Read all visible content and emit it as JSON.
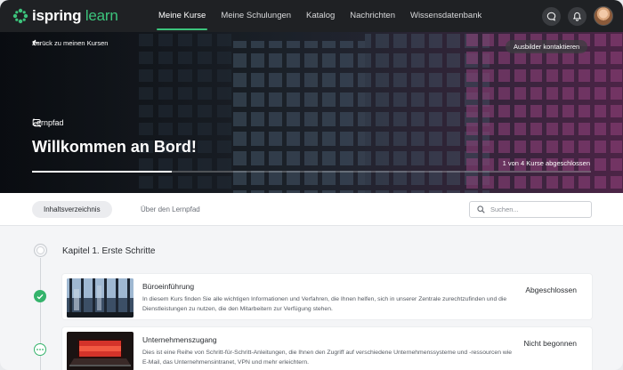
{
  "colors": {
    "accent": "#3cc47c",
    "header_bg": "#1f2124",
    "done": "#34b36b"
  },
  "brand": {
    "name_part1": "ispring",
    "name_part2": "learn"
  },
  "nav": {
    "items": [
      {
        "label": "Meine Kurse",
        "active": true
      },
      {
        "label": "Meine Schulungen",
        "active": false
      },
      {
        "label": "Katalog",
        "active": false
      },
      {
        "label": "Nachrichten",
        "active": false
      },
      {
        "label": "Wissensdatenbank",
        "active": false
      }
    ],
    "icons": [
      "chat-icon",
      "bell-icon"
    ]
  },
  "hero": {
    "back_label": "Zurück zu meinen Kursen",
    "contact_label": "Ausbilder kontaktieren",
    "type_label": "Lernpfad",
    "title": "Willkommen an Bord!",
    "progress_text": "1 von 4 Kurse abgeschlossen",
    "progress_fraction": 0.25
  },
  "tabs": {
    "items": [
      {
        "label": "Inhaltsverzeichnis",
        "active": true
      },
      {
        "label": "Über den Lernpfad",
        "active": false
      }
    ],
    "search_placeholder": "Suchen..."
  },
  "chapter": {
    "title": "Kapitel 1. Erste Schritte",
    "courses": [
      {
        "title": "Büroeinführung",
        "description": "In diesem Kurs finden Sie alle wichtigen Informationen und Verfahren, die Ihnen helfen, sich in unserer Zentrale zurechtzufinden und die Dienstleistungen zu nutzen, die den Mitarbeitern zur Verfügung stehen.",
        "status": "Abgeschlossen",
        "state": "done"
      },
      {
        "title": "Unternehmenszugang",
        "description": "Dies ist eine Reihe von Schritt-für-Schritt-Anleitungen, die Ihnen den Zugriff auf verschiedene Unternehmenssysteme und -ressourcen wie E-Mail, das Unternehmensintranet, VPN und mehr erleichtern.",
        "status": "Nicht begonnen",
        "state": "pending"
      }
    ]
  }
}
